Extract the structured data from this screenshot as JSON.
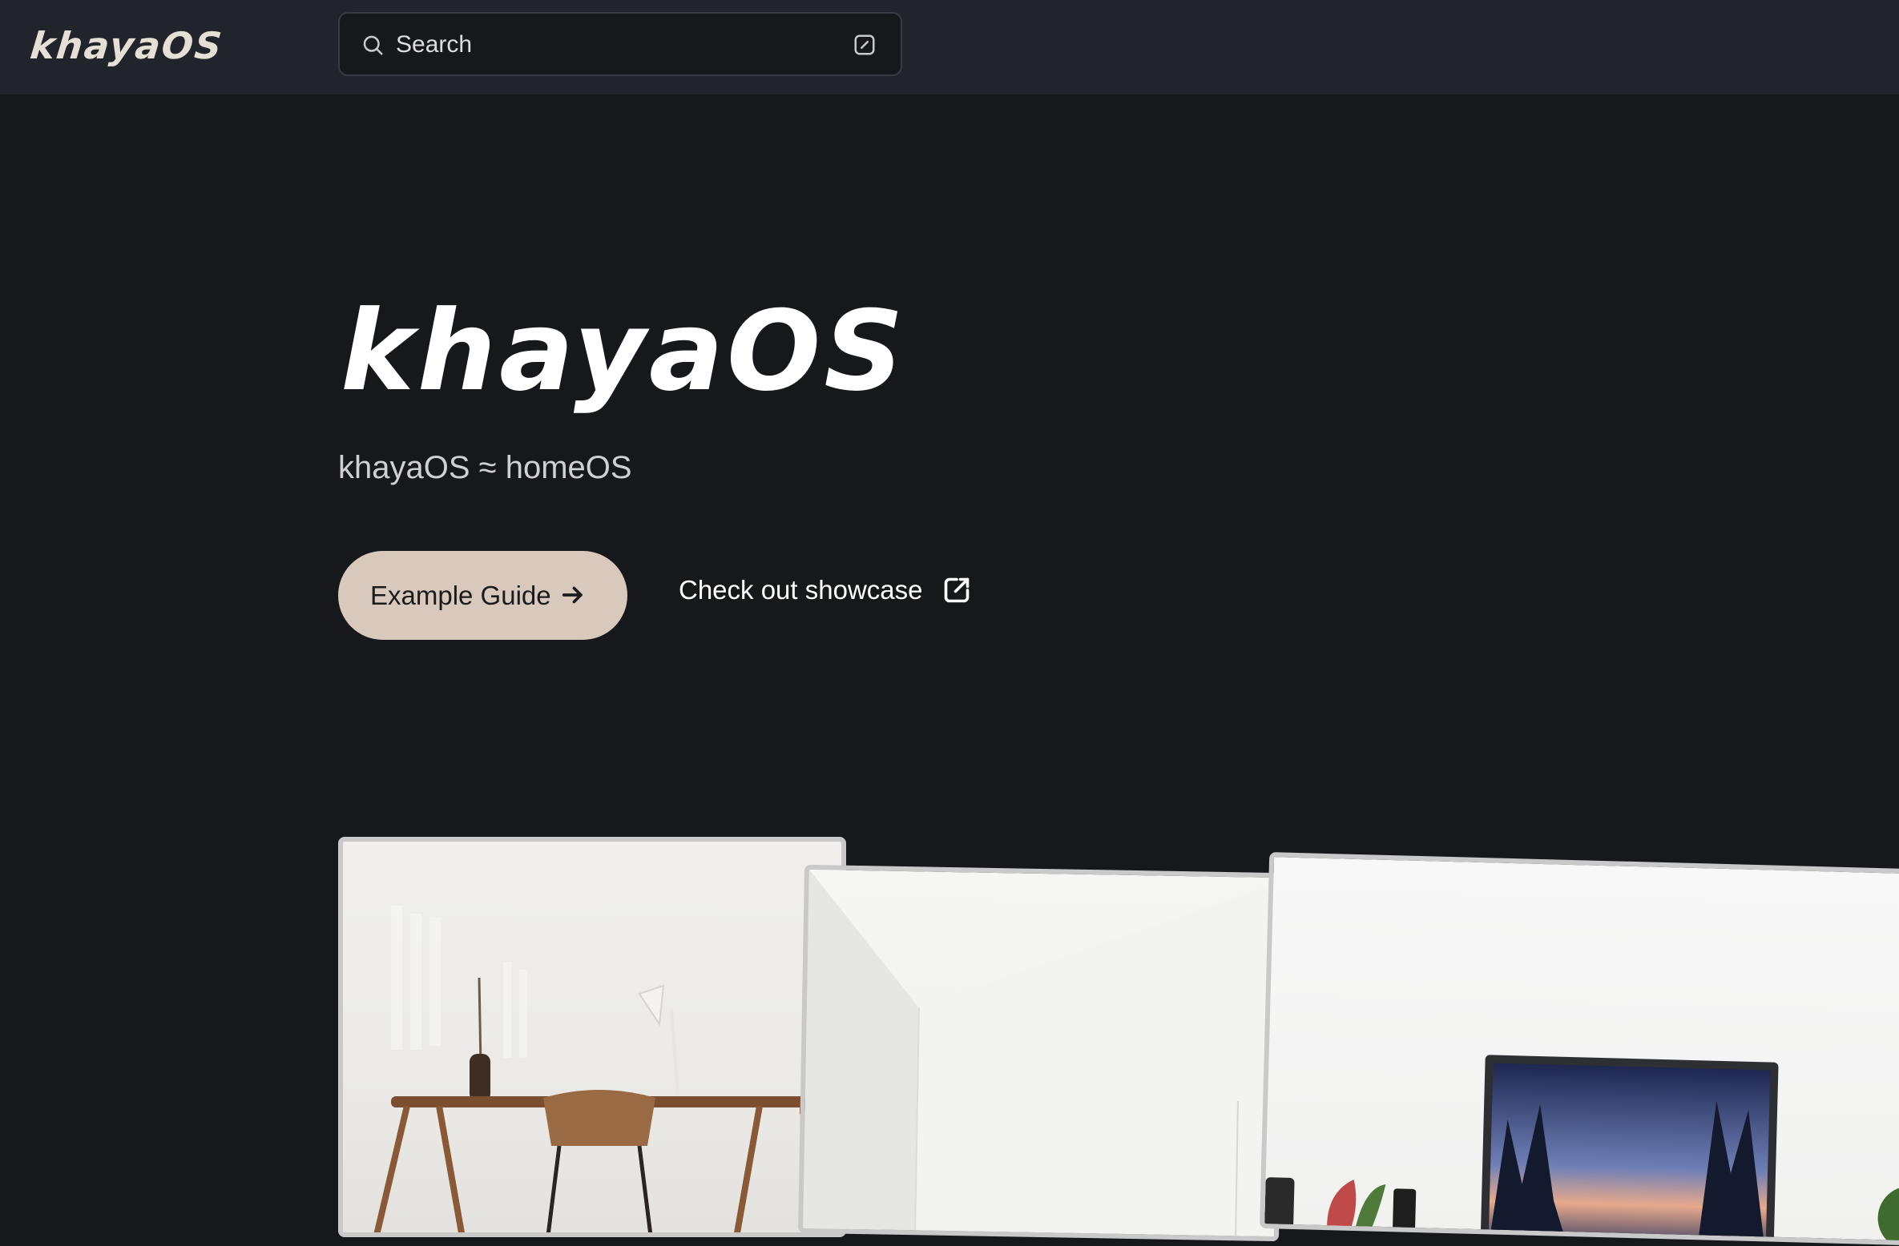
{
  "header": {
    "logo": "khayaOS",
    "search": {
      "placeholder": "Search"
    }
  },
  "hero": {
    "title": "khayaOS",
    "subtitle": "khayaOS ≈ homeOS",
    "primary_button": "Example Guide",
    "secondary_link": "Check out showcase"
  },
  "gallery": {
    "images": [
      {
        "name": "desk-with-lamp-photo"
      },
      {
        "name": "white-room-corner-photo"
      },
      {
        "name": "monitor-desk-setup-photo"
      }
    ]
  },
  "colors": {
    "background": "#17181c",
    "topbar": "#22242b",
    "accent_button": "#d9c9bd"
  }
}
